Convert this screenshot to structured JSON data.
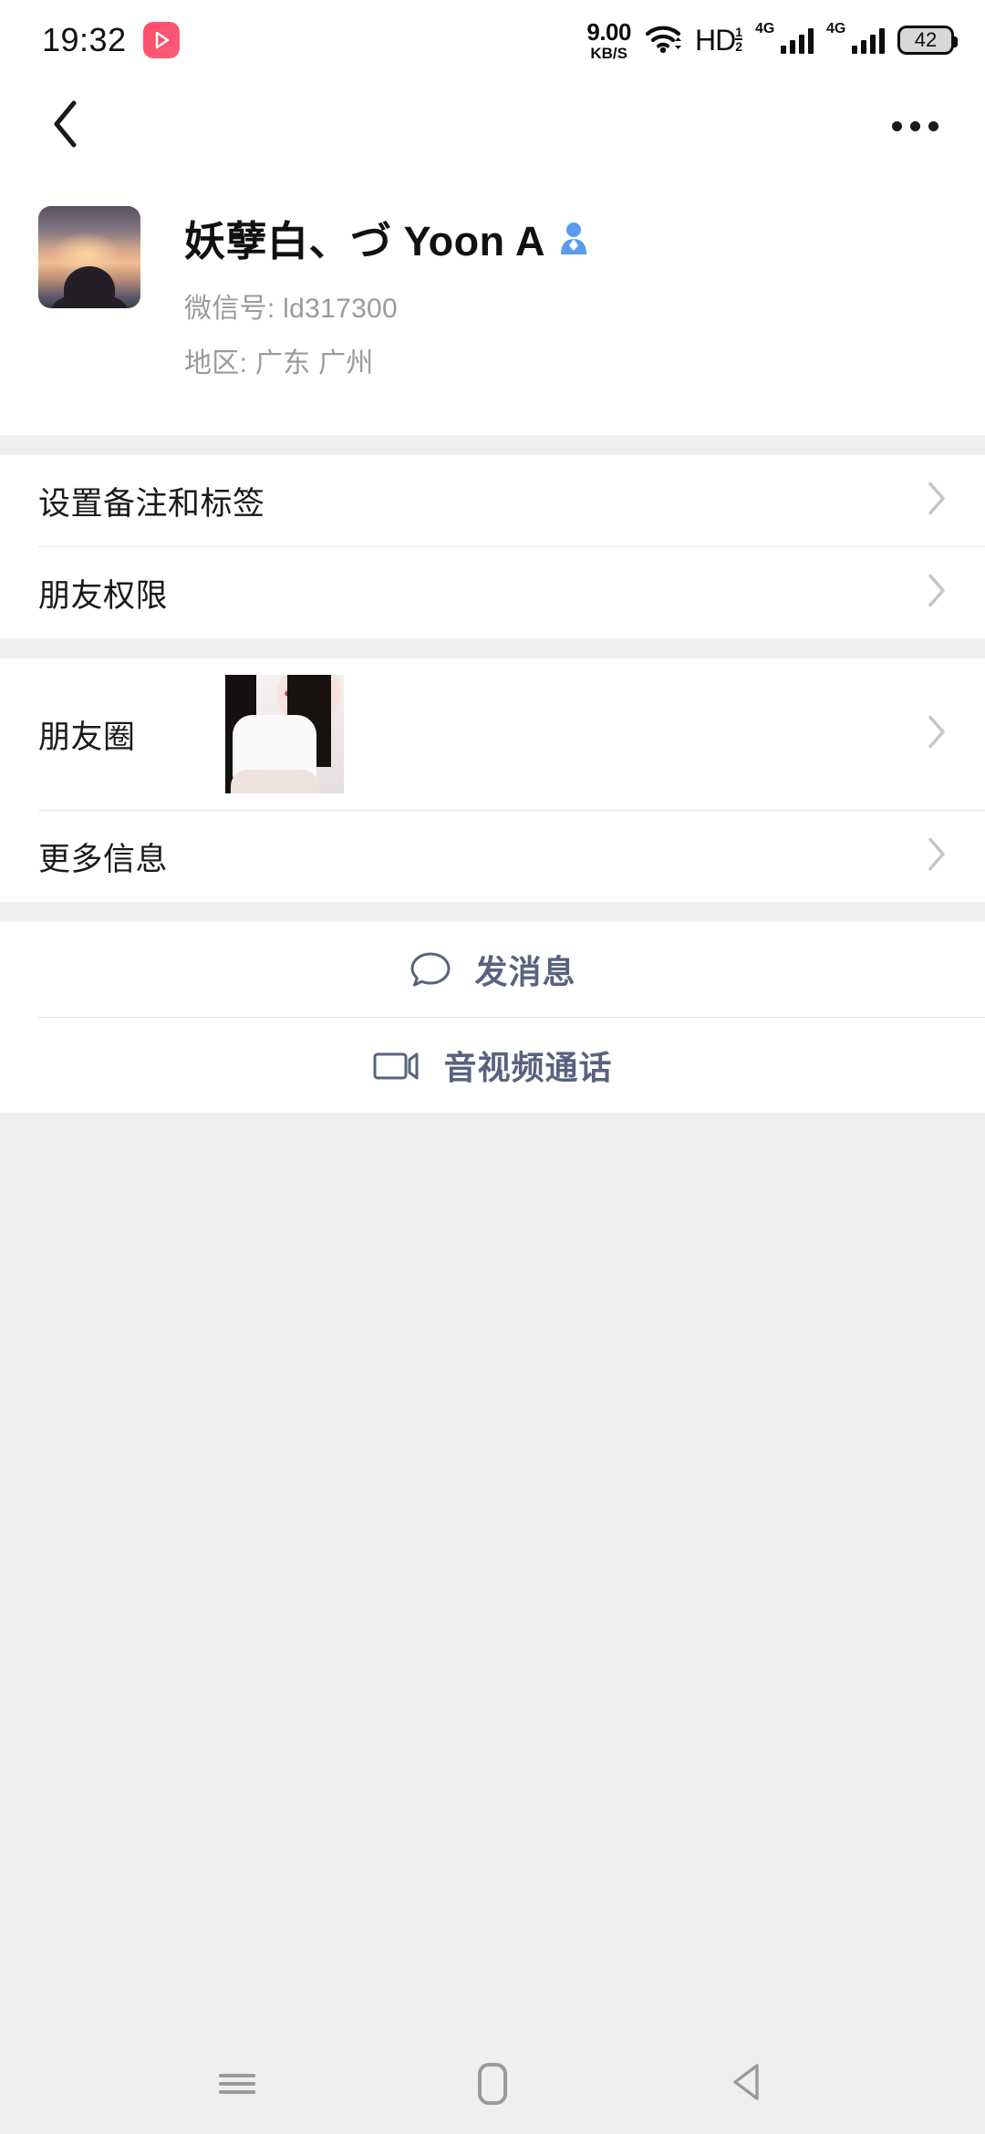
{
  "status_bar": {
    "time": "19:32",
    "app_badge_icon": "youtube-play-icon",
    "net_speed_value": "9.00",
    "net_speed_unit": "KB/S",
    "wifi_icon": "wifi-icon",
    "hd_label": "HD",
    "hd_sub_top": "1",
    "hd_sub_bottom": "2",
    "sim1_network": "4G",
    "sim2_network": "4G",
    "battery_level": "42"
  },
  "app_bar": {
    "back_icon": "chevron-left-icon",
    "more_icon": "more-horizontal-icon"
  },
  "profile": {
    "avatar_icon": "user-avatar-sunset-photo",
    "name": "妖孽白、づ Yoon A",
    "gender_icon": "male-gender-icon",
    "wechat_id_line": "微信号: ld317300",
    "region_line": "地区: 广东 广州"
  },
  "menu_groups": [
    {
      "rows": [
        {
          "label": "设置备注和标签",
          "chevron_icon": "chevron-right-icon",
          "thumb": false
        },
        {
          "label": "朋友权限",
          "chevron_icon": "chevron-right-icon",
          "thumb": false
        }
      ]
    },
    {
      "rows": [
        {
          "label": "朋友圈",
          "chevron_icon": "chevron-right-icon",
          "thumb": true,
          "thumb_icon": "moments-photo-thumbnail"
        },
        {
          "label": "更多信息",
          "chevron_icon": "chevron-right-icon",
          "thumb": false
        }
      ]
    }
  ],
  "actions": [
    {
      "label": "发消息",
      "icon": "chat-bubble-icon"
    },
    {
      "label": "音视频通话",
      "icon": "video-camera-icon"
    }
  ],
  "nav_bar": {
    "recents_icon": "recents-menu-icon",
    "home_icon": "home-square-icon",
    "back_icon": "back-triangle-icon"
  },
  "colors": {
    "page_bg": "#efefef",
    "card_bg": "#ffffff",
    "primary_text": "#1a1a1a",
    "secondary_text": "#9a9a9a",
    "action_blue": "#57637e",
    "gender_blue": "#5a9bea",
    "divider": "#e6e6e6"
  }
}
